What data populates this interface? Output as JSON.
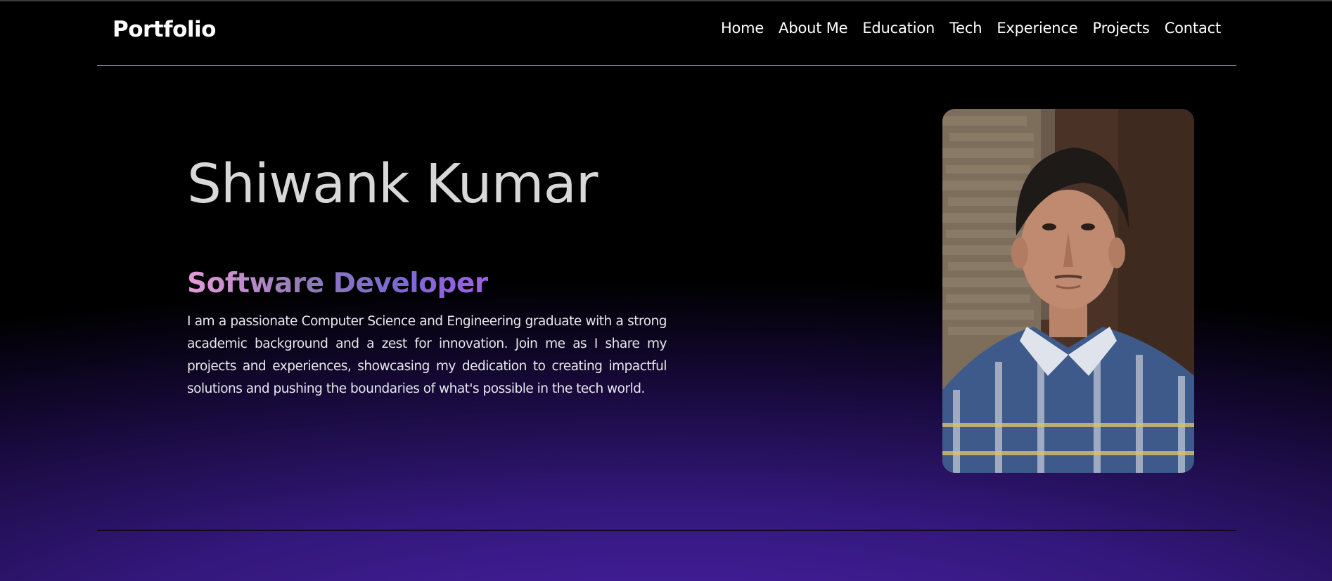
{
  "header": {
    "logo": "Portfolio",
    "nav": [
      "Home",
      "About Me",
      "Education",
      "Tech",
      "Experience",
      "Projects",
      "Contact"
    ]
  },
  "hero": {
    "name": "Shiwank Kumar",
    "role": "Software Developer",
    "bio": "I am a passionate Computer Science and Engineering graduate with a strong academic background and a zest for innovation. Join me as I share my projects and experiences, showcasing my dedication to creating impactful solutions and pushing the boundaries of what's possible in the tech world.",
    "photo": "profile-photo"
  },
  "colors": {
    "background": "#000000",
    "glow": "#4a22a8",
    "role_gradient_start": "#e79ad9",
    "role_gradient_end": "#a25ee6",
    "divider": "#9aa3b8"
  }
}
